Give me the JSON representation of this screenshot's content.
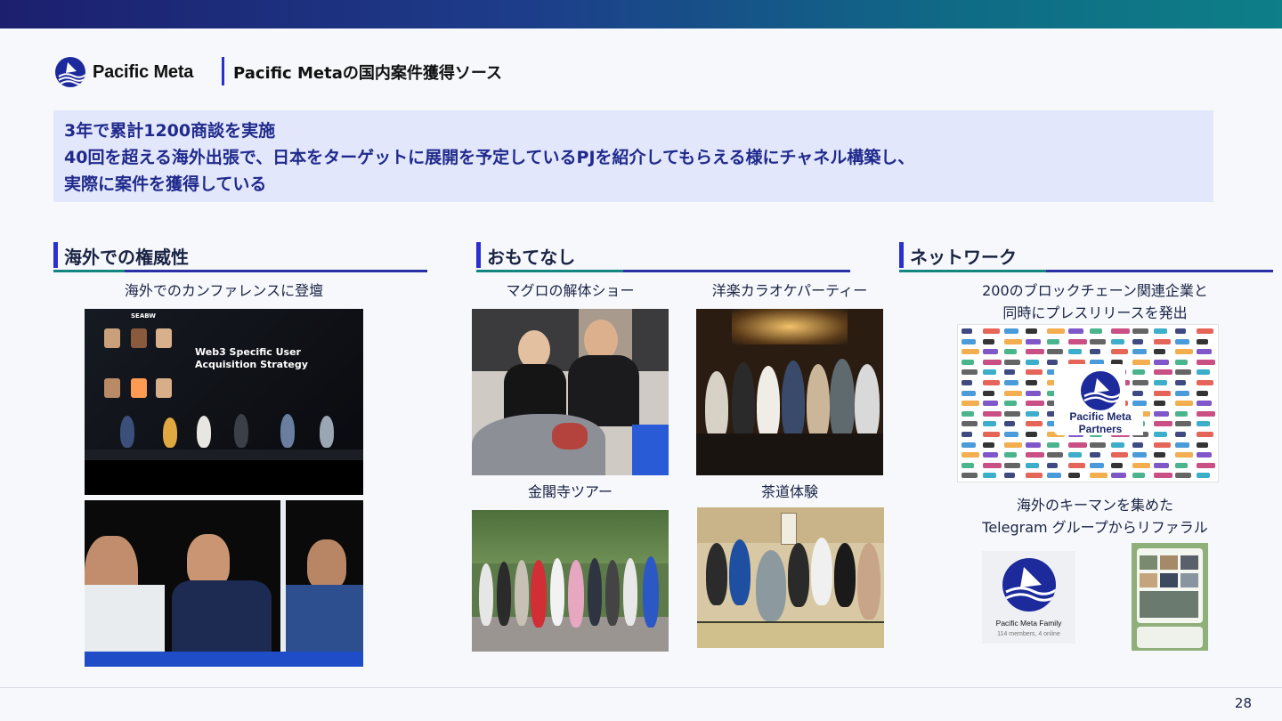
{
  "header": {
    "brand": "Pacific Meta",
    "title": "Pacific Metaの国内案件獲得ソース"
  },
  "callout": {
    "lines": [
      "3年で累計1200商談を実施",
      "40回を超える海外出張で、日本をターゲットに展開を予定しているPJを紹介してもらえる様にチャネル構築し、",
      "実際に案件を獲得している"
    ]
  },
  "sections": {
    "authority": {
      "heading": "海外での権威性",
      "caption": "海外でのカンファレンスに登壇",
      "slide_badge": "SEABW",
      "slide_title_1": "Web3 Specific User",
      "slide_title_2": "Acquisition Strategy"
    },
    "hospitality": {
      "heading": "おもてなし",
      "captions": [
        "マグロの解体ショー",
        "洋楽カラオケパーティー",
        "金閣寺ツアー",
        "茶道体験"
      ]
    },
    "network": {
      "heading": "ネットワーク",
      "caption_1a": "200のブロックチェーン関連企業と",
      "caption_1b": "同時にプレスリリースを発出",
      "partners_label_1": "Pacific Meta",
      "partners_label_2": "Partners",
      "caption_2a": "海外のキーマンを集めた",
      "caption_2b": "Telegram グループからリファラル",
      "telegram_group": "Pacific Meta Family",
      "telegram_members": "114 members, 4 online"
    }
  },
  "colors": {
    "accent": "#2a2fd0",
    "callout_bg": "#e3e7fb",
    "callout_text": "#1f2a8c",
    "teal": "#14857f"
  },
  "footer": {
    "page": "28"
  }
}
